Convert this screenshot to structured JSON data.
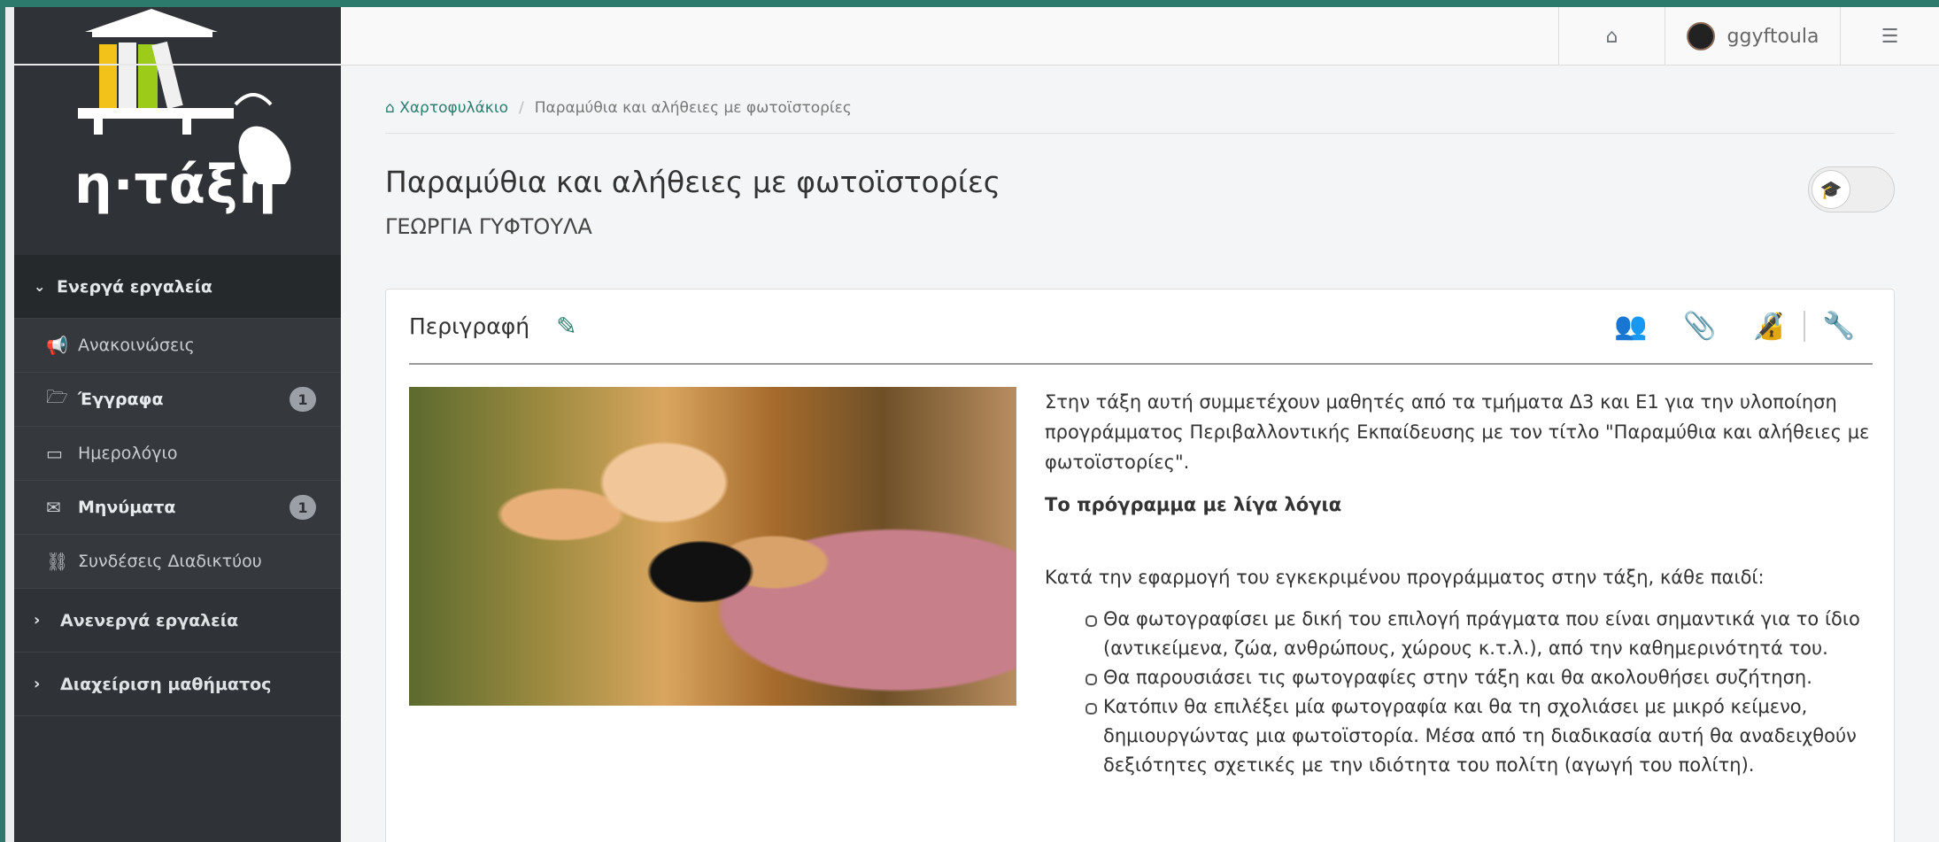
{
  "logo": {
    "text": "η·τάξη"
  },
  "topbar": {
    "username": "ggyftoula",
    "icons": [
      "home-icon",
      "settings-sliders-icon"
    ]
  },
  "sidebar": {
    "active_tools": {
      "label": "Ενεργά εργαλεία",
      "icon": "chevron-down-icon"
    },
    "items": [
      {
        "label": "Ανακοινώσεις",
        "icon": "megaphone-icon",
        "badge": ""
      },
      {
        "label": "Έγγραφα",
        "icon": "folder-open-icon",
        "badge": "1"
      },
      {
        "label": "Ημερολόγιο",
        "icon": "calendar-icon",
        "badge": ""
      },
      {
        "label": "Μηνύματα",
        "icon": "envelope-icon",
        "badge": "1"
      },
      {
        "label": "Συνδέσεις Διαδικτύου",
        "icon": "link-icon",
        "badge": ""
      }
    ],
    "inactive_tools": {
      "label": "Ανενεργά εργαλεία",
      "icon": "chevron-right-icon"
    },
    "course_admin": {
      "label": "Διαχείριση μαθήματος",
      "icon": "chevron-right-icon"
    }
  },
  "breadcrumb": {
    "home": "Χαρτοφυλάκιο",
    "separator": "/",
    "current": "Παραμύθια και αλήθειες με φωτοϊστορίες"
  },
  "page": {
    "title": "Παραμύθια και αλήθειες με φωτοϊστορίες",
    "subtitle": "ΓΕΩΡΓΙΑ ΓΥΦΤΟΥΛΑ"
  },
  "panel": {
    "title": "Περιγραφή",
    "tools": [
      "users-icon",
      "paperclip-icon",
      "pen-lock-icon",
      "wrench-icon"
    ],
    "intro": "Στην τάξη αυτή συμμετέχουν μαθητές από τα τμήματα Δ3 και Ε1 για την υλοποίηση προγράμματος Περιβαλλοντικής Εκπαίδευσης με τον τίτλο \"Παραμύθια και αλήθειες με φωτοϊστορίες\".",
    "subheading": "Το πρόγραμμα με λίγα λόγια",
    "lead": "Κατά την εφαρμογή του εγκεκριμένου προγράμματος στην τάξη, κάθε παιδί:",
    "bullets": [
      "Θα φωτογραφίσει με δική του επιλογή πράγματα που είναι σημαντικά για το ίδιο (αντικείμενα, ζώα, ανθρώπους, χώρους κ.τ.λ.), από την καθημερινότητά του.",
      "Θα παρουσιάσει τις φωτογραφίες στην τάξη και θα ακολουθήσει συζήτηση.",
      "Κατόπιν θα επιλέξει μία φωτογραφία και θα τη σχολιάσει με μικρό κείμενο, δημιουργώντας μια φωτοϊστορία. Μέσα από τη διαδικασία αυτή θα αναδειχθούν δεξιότητες σχετικές με την ιδιότητα του πολίτη (αγωγή του πολίτη)."
    ]
  },
  "colors": {
    "accent": "#2d7c6e",
    "sidebar": "#2f3236"
  }
}
